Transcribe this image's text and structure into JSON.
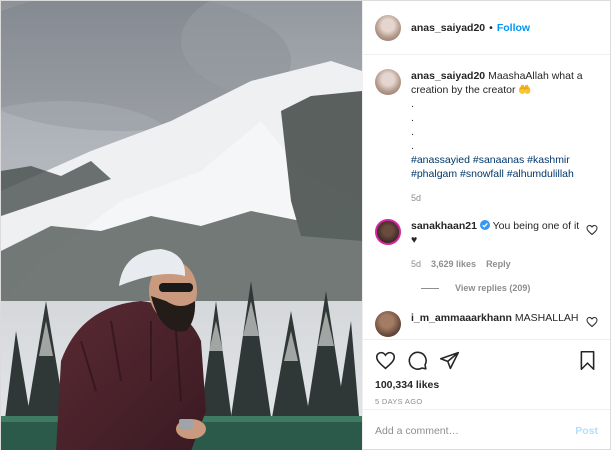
{
  "header": {
    "username": "anas_saiyad20",
    "separator": "•",
    "follow_label": "Follow"
  },
  "caption": {
    "username": "anas_saiyad20",
    "text": "MaashaAllah what a creation by the creator",
    "emoji": "🤲",
    "dots": [
      ".",
      ".",
      ".",
      "."
    ],
    "hashtags": "#anassayied #sanaanas #kashmir #phalgam #snowfall #alhumdulillah",
    "age": "5d"
  },
  "comments": [
    {
      "username": "sanakhaan21",
      "verified": true,
      "text": "You being one of it",
      "suffix": "♥",
      "age": "5d",
      "likes": "3,629 likes",
      "reply_label": "Reply",
      "view_replies": "View replies (209)"
    },
    {
      "username": "i_m_ammaaarkhann",
      "text": "MASHALLAH"
    }
  ],
  "actions": {
    "like_count": "100,334 likes",
    "posted": "5 DAYS AGO"
  },
  "add_comment": {
    "placeholder": "Add a comment…",
    "post_label": "Post"
  },
  "colors": {
    "link_blue": "#0095f6",
    "hashtag": "#00376b",
    "muted": "#8e8e8e",
    "post_disabled": "#b2dffc"
  },
  "icons": [
    "heart-icon",
    "comment-icon",
    "share-icon",
    "bookmark-icon",
    "verified-icon"
  ]
}
